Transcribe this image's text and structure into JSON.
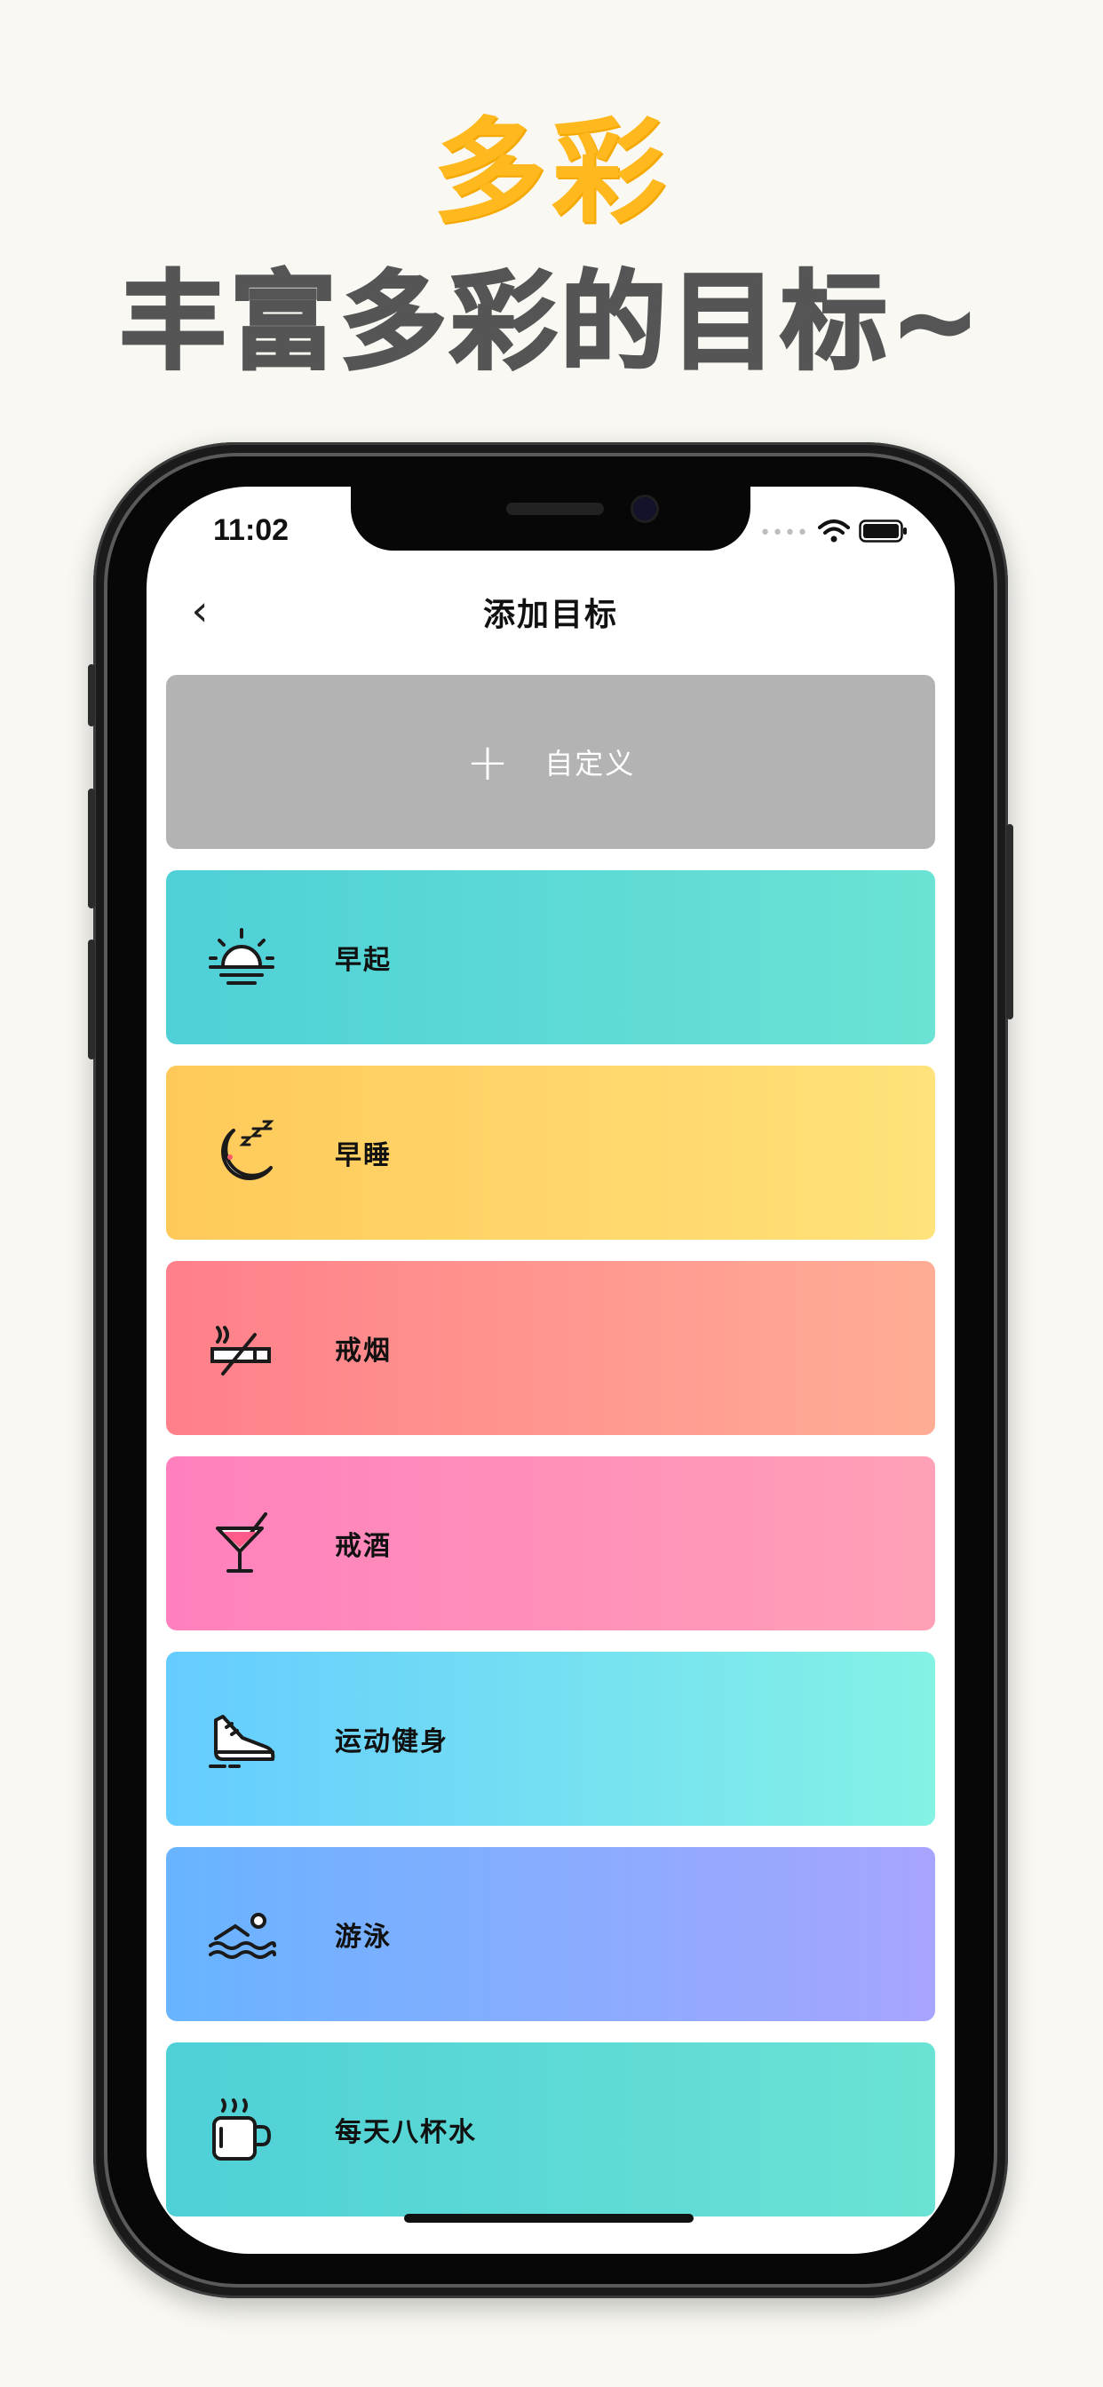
{
  "marketing": {
    "tag": "多彩",
    "headline": "丰富多彩的目标~"
  },
  "status_bar": {
    "time": "11:02",
    "signal": "••••"
  },
  "nav": {
    "back_icon": "chevron-left-icon",
    "back_glyph": "‹",
    "title": "添加目标"
  },
  "custom_card": {
    "plus": "+",
    "label": "自定义",
    "color": "#b3b3b3"
  },
  "goals": [
    {
      "label": "早起",
      "icon": "sunrise-icon",
      "gradient": [
        "#4fd0d7",
        "#6ae3d4"
      ]
    },
    {
      "label": "早睡",
      "icon": "moon-sleep-icon",
      "gradient": [
        "#ffc95a",
        "#ffe27a"
      ]
    },
    {
      "label": "戒烟",
      "icon": "no-smoking-icon",
      "gradient": [
        "#ff7f8a",
        "#ffad95"
      ]
    },
    {
      "label": "戒酒",
      "icon": "cocktail-icon",
      "gradient": [
        "#ff80bd",
        "#ffa0b6"
      ]
    },
    {
      "label": "运动健身",
      "icon": "sneaker-icon",
      "gradient": [
        "#65ccff",
        "#84f2e5"
      ]
    },
    {
      "label": "游泳",
      "icon": "swimmer-icon",
      "gradient": [
        "#68b4ff",
        "#a7a4ff"
      ]
    },
    {
      "label": "每天八杯水",
      "icon": "mug-icon",
      "gradient": [
        "#4fd0d7",
        "#6ae3d4"
      ]
    }
  ]
}
